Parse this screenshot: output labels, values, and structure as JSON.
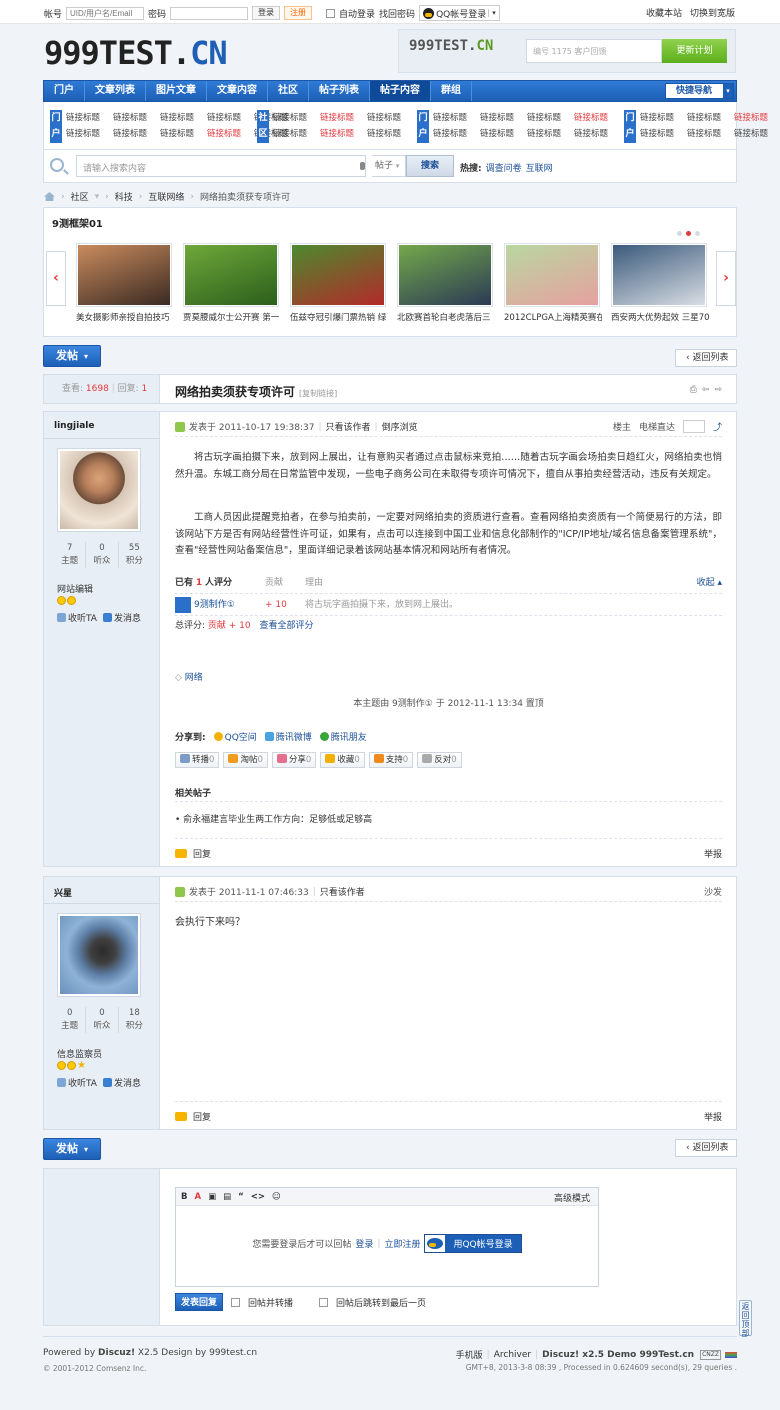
{
  "topbar": {
    "account_label": "帐号",
    "account_placeholder": "UID/用户名/Email",
    "password_label": "密码",
    "login": "登录",
    "register": "注册",
    "auto_login": "自动登录",
    "find_password": "找回密码",
    "qq_login": "QQ帐号登录",
    "bookmark": "收藏本站",
    "switch_width": "切换到宽版"
  },
  "logo": {
    "main": "999TEST.",
    "suffix": "CN"
  },
  "ad": {
    "logo_main": "999TEST.",
    "logo_suffix": "CN",
    "input_text": "编号 1175 客户回馈",
    "button": "更新计划"
  },
  "nav": {
    "items": [
      "门户",
      "文章列表",
      "图片文章",
      "文章内容",
      "社区",
      "帖子列表",
      "帖子内容",
      "群组"
    ],
    "active": 6,
    "quick": "快捷导航"
  },
  "links": {
    "groups": [
      {
        "tag": "门户",
        "cells": [
          {
            "t": "链接标题",
            "r": false
          },
          {
            "t": "链接标题",
            "r": false
          },
          {
            "t": "链接标题",
            "r": false
          },
          {
            "t": "链接标题",
            "r": false
          },
          {
            "t": "链接标题",
            "r": false
          },
          {
            "t": "链接标题",
            "r": false
          },
          {
            "t": "链接标题",
            "r": false
          },
          {
            "t": "链接标题",
            "r": false
          },
          {
            "t": "链接标题",
            "r": true
          },
          {
            "t": "链接标题",
            "r": false
          }
        ]
      },
      {
        "tag": "社区",
        "cells": [
          {
            "t": "链接标题",
            "r": false
          },
          {
            "t": "链接标题",
            "r": true
          },
          {
            "t": "链接标题",
            "r": false
          },
          {
            "t": "链接标题",
            "r": false
          },
          {
            "t": "链接标题",
            "r": true
          },
          {
            "t": "链接标题",
            "r": false
          }
        ]
      },
      {
        "tag": "门户",
        "cells": [
          {
            "t": "链接标题",
            "r": false
          },
          {
            "t": "链接标题",
            "r": false
          },
          {
            "t": "链接标题",
            "r": false
          },
          {
            "t": "链接标题",
            "r": true
          },
          {
            "t": "链接标题",
            "r": false
          },
          {
            "t": "链接标题",
            "r": false
          },
          {
            "t": "链接标题",
            "r": false
          },
          {
            "t": "链接标题",
            "r": false
          }
        ]
      },
      {
        "tag": "门户",
        "cells": [
          {
            "t": "链接标题",
            "r": false
          },
          {
            "t": "链接标题",
            "r": false
          },
          {
            "t": "链接标题",
            "r": true
          },
          {
            "t": "链接标题",
            "r": false
          },
          {
            "t": "链接标题",
            "r": false
          },
          {
            "t": "链接标题",
            "r": false
          }
        ]
      }
    ]
  },
  "search": {
    "placeholder": "请输入搜索内容",
    "filter": "帖子",
    "button": "搜索",
    "hot_label": "热搜:",
    "hot": [
      "调查问卷",
      "互联网"
    ]
  },
  "breadcrumb": [
    "社区",
    "科技",
    "互联网络",
    "网络拍卖须获专项许可"
  ],
  "slider": {
    "title": "9测框架01",
    "items": [
      {
        "caption": "美女摄影师亲授自拍技巧",
        "colors": [
          "#c98b5e",
          "#3a2a22"
        ]
      },
      {
        "caption": "贾莫腰威尔士公开赛 第一",
        "colors": [
          "#6fa83a",
          "#2c5e1c"
        ]
      },
      {
        "caption": "伍兹夺冠引爆门票热销 绿",
        "colors": [
          "#4c8a2e",
          "#b32a2a"
        ]
      },
      {
        "caption": "北欧赛首轮白老虎落后三",
        "colors": [
          "#74a84b",
          "#2b3a55"
        ]
      },
      {
        "caption": "2012CLPGA上海精英赛在",
        "colors": [
          "#b8d7a0",
          "#e6a0a0"
        ]
      },
      {
        "caption": "西安两大优势起效 三星70",
        "colors": [
          "#3b5a7c",
          "#d9dde3"
        ]
      }
    ]
  },
  "buttons": {
    "post": "发帖",
    "back": "返回列表"
  },
  "thread": {
    "views_label": "查看:",
    "views": "1698",
    "replies_label": "回复:",
    "replies": "1",
    "title": "网络拍卖须获专项许可",
    "copy_link": "[复制链接]"
  },
  "post1": {
    "author": "lingjiale",
    "stats": [
      {
        "n": "7",
        "l": "主题"
      },
      {
        "n": "0",
        "l": "听众"
      },
      {
        "n": "55",
        "l": "积分"
      }
    ],
    "role": "网站编辑",
    "follow": "收听TA",
    "message": "发消息",
    "posted": "发表于 2011-10-17 19:38:37",
    "only_author": "只看该作者",
    "reverse": "倒序浏览",
    "floor": "楼主",
    "jump": "电梯直达",
    "paragraphs": [
      "将古玩字画拍摄下来，放到网上展出，让有意购买者通过点击鼠标来竞拍……随着古玩字画会场拍卖日趋红火，网络拍卖也悄然升温。东城工商分局在日常监管中发现，一些电子商务公司在未取得专项许可情况下，擅自从事拍卖经营活动，违反有关规定。",
      "工商人员因此提醒竞拍者，在参与拍卖前，一定要对网络拍卖的资质进行查看。查看网络拍卖资质有一个简便易行的方法，即该网站下方是否有网站经营性许可证，如果有，点击可以连接到中国工业和信息化部制作的\"ICP/IP地址/域名信息备案管理系统\"，查看\"经营性网站备案信息\"，里面详细记录着该网站基本情况和网站所有者情况。"
    ],
    "rate_header": {
      "pre": "已有",
      "count": "1",
      "post": "人评分",
      "col2": "贡献",
      "col3": "理由",
      "collapse": "收起"
    },
    "rate_row": {
      "user": "9测制作①",
      "score": "+ 10",
      "reason": "将古玩字画拍摄下来，放到网上展出。"
    },
    "rate_sum": {
      "label": "总评分:",
      "item": "贡献 + 10",
      "all": "查看全部评分"
    },
    "tag": "网络",
    "edited": "本主题由 9测制作① 于 2012-11-1 13:34 置顶",
    "share_label": "分享到:",
    "shares": [
      "QQ空间",
      "腾讯微博",
      "腾讯朋友"
    ],
    "actions": [
      {
        "l": "转播",
        "n": "0"
      },
      {
        "l": "淘帖",
        "n": "0"
      },
      {
        "l": "分享",
        "n": "0"
      },
      {
        "l": "收藏",
        "n": "0"
      },
      {
        "l": "支持",
        "n": "0"
      },
      {
        "l": "反对",
        "n": "0"
      }
    ],
    "related_title": "相关帖子",
    "related": "• 俞永福建言毕业生两工作方向：足够低或足够高",
    "reply": "回复",
    "report": "举报"
  },
  "post2": {
    "author": "兴星",
    "stats": [
      {
        "n": "0",
        "l": "主题"
      },
      {
        "n": "0",
        "l": "听众"
      },
      {
        "n": "18",
        "l": "积分"
      }
    ],
    "role": "信息监察员",
    "follow": "收听TA",
    "message": "发消息",
    "posted": "发表于 2011-11-1 07:46:33",
    "only_author": "只看该作者",
    "floor": "沙发",
    "content": "会执行下来吗？",
    "reply": "回复",
    "report": "举报"
  },
  "editor": {
    "tools": [
      "B",
      "A",
      "▣",
      "▤",
      "“",
      "<>",
      "☺"
    ],
    "advanced": "高级模式",
    "notice": "您需要登录后才可以回帖",
    "login": "登录",
    "separator": "|",
    "register": "立即注册",
    "qq_login": "用QQ帐号登录",
    "submit": "发表回复",
    "opt1": "回帖并转播",
    "opt2": "回帖后跳转到最后一页"
  },
  "footer": {
    "powered_pre": "Powered by",
    "powered_b": "Discuz!",
    "powered_post": "X2.5 Design by 999test.cn",
    "copyright": "© 2001-2012 Comsenz Inc.",
    "mobile": "手机版",
    "archiver": "Archiver",
    "sep": "|",
    "demo": "Discuz! x2.5 Demo 999Test.cn",
    "badge": "CNZZ",
    "gmt": "GMT+8, 2013-3-8 08:39 , Processed in 0.624609 second(s), 29 queries ."
  },
  "totop": "返回顶部"
}
